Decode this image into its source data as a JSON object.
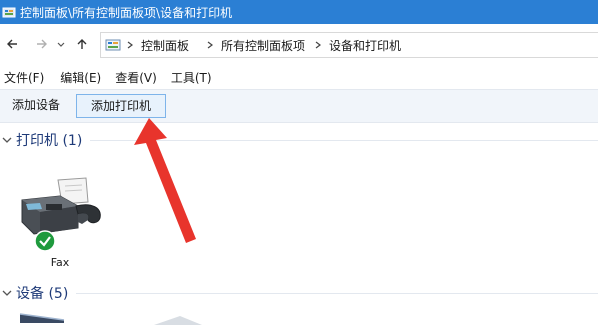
{
  "window": {
    "title": "控制面板\\所有控制面板项\\设备和打印机",
    "titlebar_color": "#2b7fd4"
  },
  "nav": {
    "back_icon": "arrow-left-icon",
    "forward_icon": "arrow-right-icon",
    "recent_icon": "chevron-down-icon",
    "up_icon": "arrow-up-icon"
  },
  "address": {
    "icon": "control-panel-icon",
    "crumbs": [
      "控制面板",
      "所有控制面板项",
      "设备和打印机"
    ]
  },
  "menu": {
    "items": [
      "文件(F)",
      "编辑(E)",
      "查看(V)",
      "工具(T)"
    ]
  },
  "commands": {
    "add_device": "添加设备",
    "add_printer": "添加打印机"
  },
  "groups": {
    "printers": {
      "label": "打印机 (1)"
    },
    "devices": {
      "label": "设备 (5)"
    }
  },
  "printers": {
    "items": [
      {
        "name": "Fax",
        "icon": "fax-icon",
        "status_icon": "checkmark-icon"
      }
    ]
  },
  "colors": {
    "accent": "#2b7fd4",
    "group_header": "#1e3a78",
    "annotation_arrow": "#e8342c",
    "status_ok": "#1f9a3d"
  }
}
